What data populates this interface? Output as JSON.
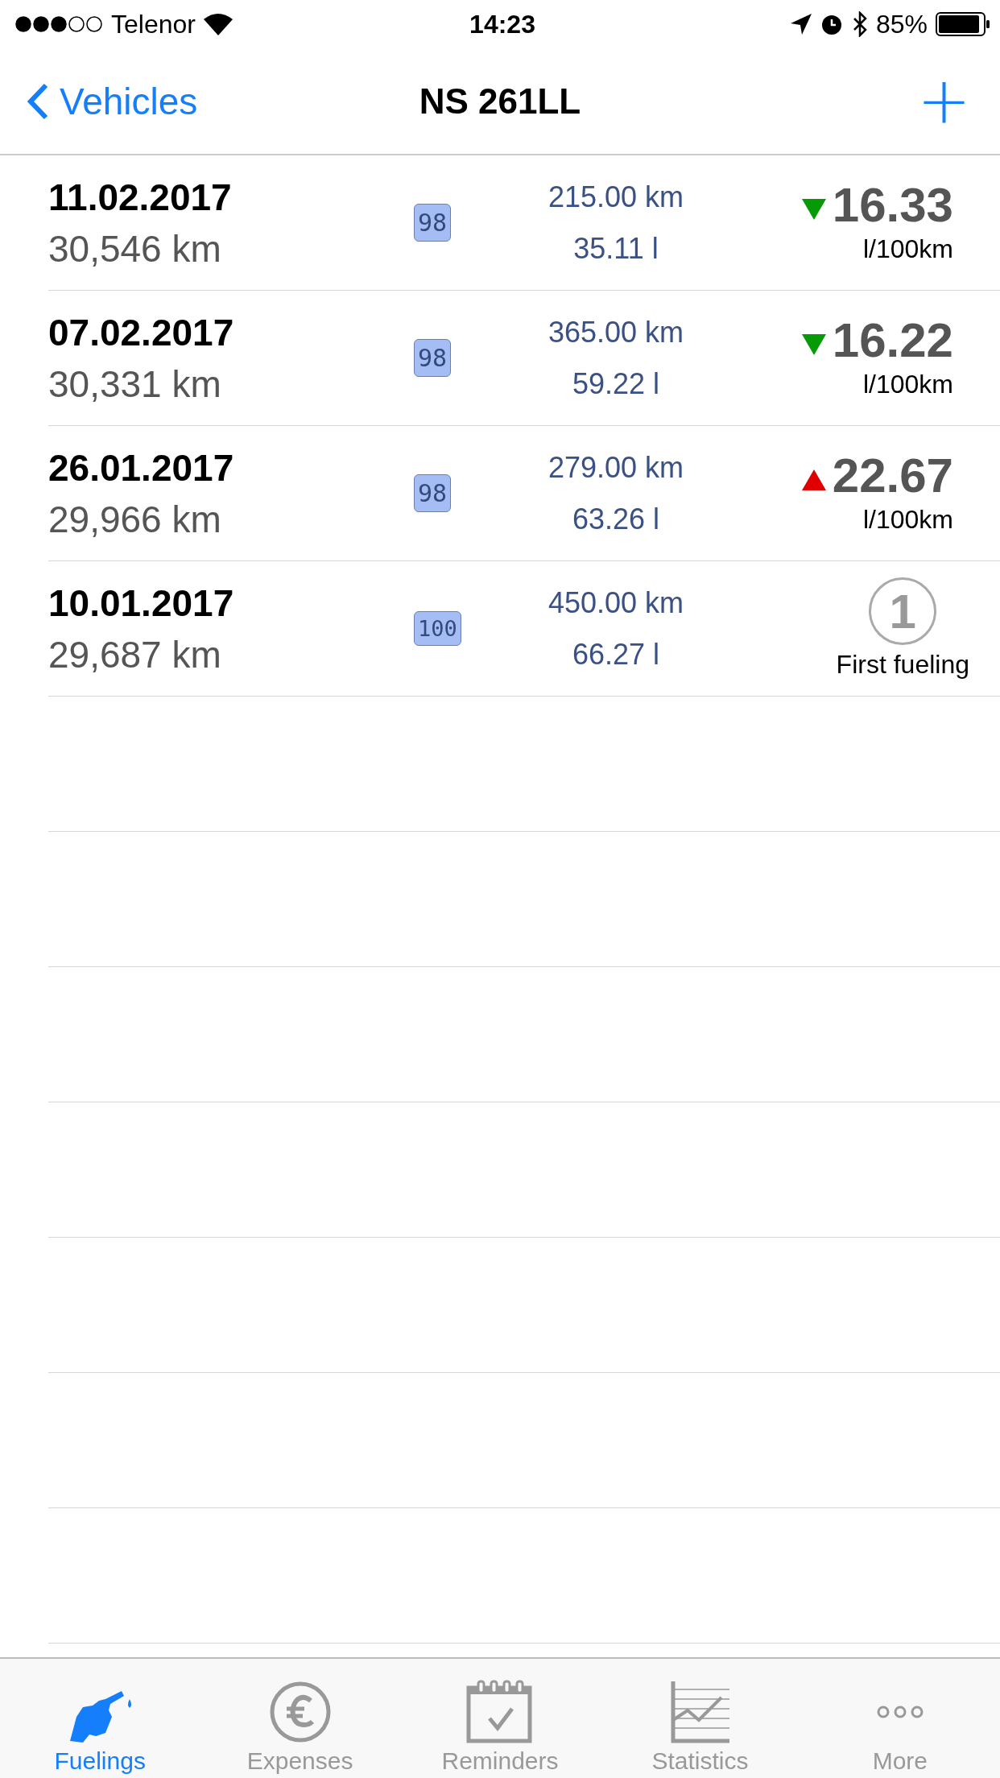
{
  "status_bar": {
    "carrier": "Telenor",
    "time": "14:23",
    "battery": "85%"
  },
  "nav": {
    "back": "Vehicles",
    "title": "NS 261LL",
    "add": "+"
  },
  "fuelings": [
    {
      "kind": "consumption",
      "date": "11.02.2017",
      "odometer": "30,546 km",
      "grade": "98",
      "distance": "215.00 km",
      "volume": "35.11 l",
      "rising": false,
      "consumption": "16.33",
      "unit": "l/100km"
    },
    {
      "kind": "consumption",
      "date": "07.02.2017",
      "odometer": "30,331 km",
      "grade": "98",
      "distance": "365.00 km",
      "volume": "59.22 l",
      "rising": false,
      "consumption": "16.22",
      "unit": "l/100km"
    },
    {
      "kind": "consumption",
      "date": "26.01.2017",
      "odometer": "29,966 km",
      "grade": "98",
      "distance": "279.00 km",
      "volume": "63.26 l",
      "rising": true,
      "consumption": "22.67",
      "unit": "l/100km"
    },
    {
      "kind": "first",
      "date": "10.01.2017",
      "odometer": "29,687 km",
      "grade": "100",
      "distance": "450.00 km",
      "volume": "66.27 l",
      "badge": "1",
      "label": "First fueling"
    }
  ],
  "tabs": [
    {
      "kind": "fuel",
      "label": "Fuelings",
      "selected": true
    },
    {
      "kind": "euro",
      "label": "Expenses",
      "selected": false
    },
    {
      "kind": "calendar",
      "label": "Reminders",
      "selected": false
    },
    {
      "kind": "chart",
      "label": "Statistics",
      "selected": false
    },
    {
      "kind": "more",
      "label": "More",
      "selected": false
    }
  ]
}
